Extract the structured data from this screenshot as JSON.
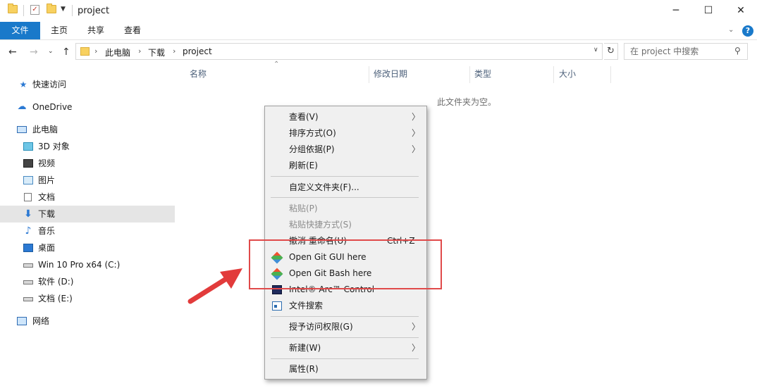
{
  "window": {
    "title": "project",
    "minimize_glyph": "─",
    "maximize_glyph": "☐",
    "close_glyph": "✕"
  },
  "quick_access_toolbar": {
    "icons": [
      "folder-icon",
      "properties-check-icon",
      "new-folder-icon",
      "customize-dropdown-icon"
    ]
  },
  "ribbon": {
    "tabs": [
      {
        "label": "文件",
        "active": true
      },
      {
        "label": "主页"
      },
      {
        "label": "共享"
      },
      {
        "label": "查看"
      }
    ],
    "help_glyph": "?"
  },
  "address_bar": {
    "breadcrumbs": [
      "此电脑",
      "下载",
      "project"
    ],
    "search_placeholder": "在 project 中搜索"
  },
  "sidebar": {
    "items": [
      {
        "label": "快速访问",
        "icon": "star-icon"
      },
      {
        "label": "OneDrive",
        "icon": "cloud-icon"
      },
      {
        "label": "此电脑",
        "icon": "computer-icon"
      },
      {
        "label": "3D 对象",
        "icon": "cube-3d-icon"
      },
      {
        "label": "视频",
        "icon": "video-icon"
      },
      {
        "label": "图片",
        "icon": "picture-icon"
      },
      {
        "label": "文档",
        "icon": "document-icon"
      },
      {
        "label": "下载",
        "icon": "download-arrow-icon",
        "selected": true
      },
      {
        "label": "音乐",
        "icon": "music-note-icon"
      },
      {
        "label": "桌面",
        "icon": "desktop-icon"
      },
      {
        "label": "Win 10 Pro x64 (C:)",
        "icon": "drive-system-icon"
      },
      {
        "label": "软件 (D:)",
        "icon": "drive-icon"
      },
      {
        "label": "文档 (E:)",
        "icon": "drive-icon"
      },
      {
        "label": "网络",
        "icon": "network-icon"
      }
    ]
  },
  "file_list": {
    "columns": [
      "名称",
      "修改日期",
      "类型",
      "大小"
    ],
    "empty_message": "此文件夹为空。"
  },
  "context_menu": {
    "items": [
      {
        "label": "查看(V)",
        "submenu": true
      },
      {
        "label": "排序方式(O)",
        "submenu": true
      },
      {
        "label": "分组依据(P)",
        "submenu": true
      },
      {
        "label": "刷新(E)"
      },
      {
        "label": "自定义文件夹(F)..."
      },
      {
        "label": "粘贴(P)",
        "disabled": true
      },
      {
        "label": "粘贴快捷方式(S)",
        "disabled": true
      },
      {
        "label": "撤消 重命名(U)",
        "shortcut": "Ctrl+Z"
      },
      {
        "label": "Open Git GUI here",
        "icon": "git-icon"
      },
      {
        "label": "Open Git Bash here",
        "icon": "git-icon"
      },
      {
        "label": "Intel® Arc™ Control",
        "icon": "intel-arc-icon"
      },
      {
        "label": "文件搜索",
        "icon": "file-search-icon"
      },
      {
        "label": "授予访问权限(G)",
        "submenu": true
      },
      {
        "label": "新建(W)",
        "submenu": true
      },
      {
        "label": "属性(R)"
      }
    ]
  },
  "annotation": {
    "highlight_color": "#e04a4a",
    "arrow_color": "#e23b3b"
  },
  "colors": {
    "accent": "#1979ca",
    "selection": "#e5e5e5",
    "menu_background": "#f0f0f0"
  }
}
